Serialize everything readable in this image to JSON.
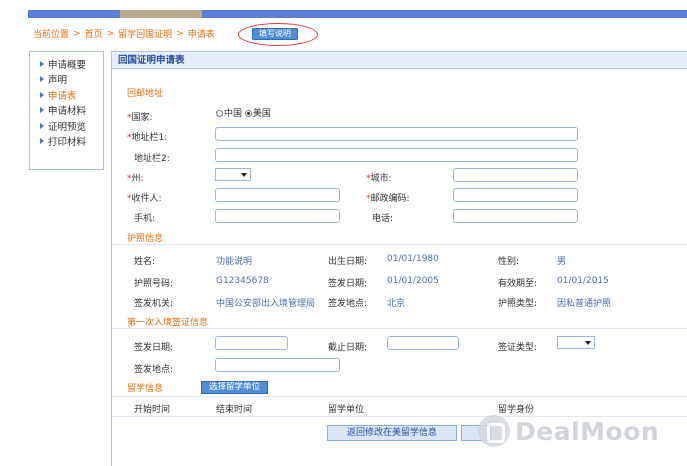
{
  "topbar": {
    "right_text": ""
  },
  "breadcrumb": {
    "items": [
      "当前位置",
      "首页",
      "留学回国证明",
      "申请表"
    ],
    "separator": ">"
  },
  "fill_button": "填写说明",
  "sidebar": {
    "items": [
      {
        "label": "申请概要",
        "active": false
      },
      {
        "label": "声明",
        "active": false
      },
      {
        "label": "申请表",
        "active": true
      },
      {
        "label": "申请材料",
        "active": false
      },
      {
        "label": "证明预览",
        "active": false
      },
      {
        "label": "打印材料",
        "active": false
      }
    ]
  },
  "panel": {
    "title": "回国证明申请表"
  },
  "mailing": {
    "section": "回邮地址",
    "country_label": "国家:",
    "country_options": [
      "中国",
      "美国"
    ],
    "country_selected": "美国",
    "address1_label": "地址栏1:",
    "address2_label": "地址栏2:",
    "state_label": "州:",
    "city_label": "城市:",
    "recipient_label": "收件人:",
    "zip_label": "邮政编码:",
    "mobile_label": "手机:",
    "phone_label": "电话:",
    "required_mark": "*"
  },
  "passport": {
    "section": "护照信息",
    "name_label": "姓名:",
    "name_value": "功能说明",
    "dob_label": "出生日期:",
    "dob_value": "01/01/1980",
    "gender_label": "性别:",
    "gender_value": "男",
    "number_label": "护照号码:",
    "number_value": "G12345678",
    "issue_date_label": "签发日期:",
    "issue_date_value": "01/01/2005",
    "expiry_label": "有效期至:",
    "expiry_value": "01/01/2015",
    "authority_label": "签发机关:",
    "authority_value": "中国公安部出入境管理局",
    "issue_place_label": "签发地点:",
    "issue_place_value": "北京",
    "type_label": "护照类型:",
    "type_value": "因私普通护照"
  },
  "visa": {
    "section": "第一次入境签证信息",
    "issue_date_label": "签发日期:",
    "end_date_label": "截止日期:",
    "type_label": "签证类型:",
    "issue_place_label": "签发地点:"
  },
  "study": {
    "section": "留学信息",
    "pick_button": "选择留学单位",
    "columns": [
      "开始时间",
      "结束时间",
      "留学单位",
      "留学身份"
    ]
  },
  "footer": {
    "back_button": "返回修改在美留学信息"
  },
  "watermark": {
    "text": "DealMoon"
  }
}
